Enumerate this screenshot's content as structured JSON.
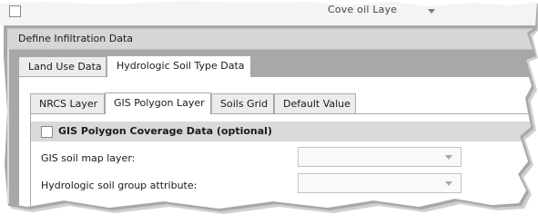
{
  "overlap_fragment": {
    "title": "Cove   oil Laye"
  },
  "section_header": "Define Infiltration Data",
  "outer_tabs": [
    {
      "label": "Land Use Data",
      "active": false
    },
    {
      "label": "Hydrologic Soil Type Data",
      "active": true
    }
  ],
  "inner_tabs": [
    {
      "label": "NRCS Layer",
      "active": false
    },
    {
      "label": "GIS Polygon Layer",
      "active": true
    },
    {
      "label": "Soils Grid",
      "active": false
    },
    {
      "label": "Default Value",
      "active": false
    }
  ],
  "group": {
    "label": "GIS Polygon Coverage Data (optional)",
    "checked": false
  },
  "fields": {
    "soil_map_layer": {
      "label": "GIS soil map layer:",
      "value": ""
    },
    "soil_group_attribute": {
      "label": "Hydrologic soil group attribute:",
      "value": ""
    }
  },
  "icons": {
    "dropdown": "chevron-down-icon",
    "checkbox": "checkbox-icon"
  },
  "colors": {
    "header_band": "#d6d6d6",
    "group_band": "#d9d9d9",
    "tab_border": "#a9a9a9"
  }
}
